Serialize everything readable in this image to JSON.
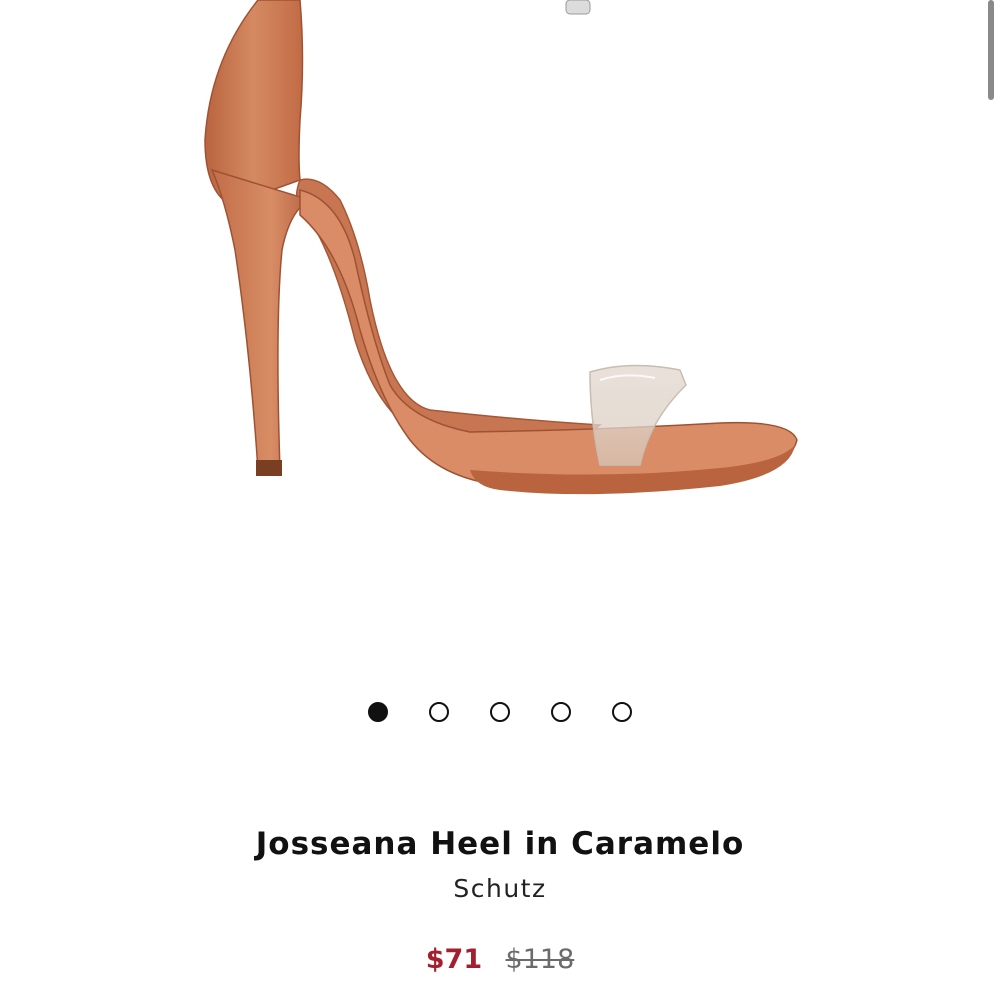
{
  "product": {
    "title": "Josseana Heel in Caramelo",
    "brand": "Schutz",
    "sale_price": "$71",
    "original_price": "$118",
    "image_alt": "heel-sandal-photo"
  },
  "carousel": {
    "total_images": 5,
    "active_index": 0
  },
  "colors": {
    "sale_price": "#a31f2d",
    "original_price": "#6b6b6b",
    "text": "#111111",
    "leather": "#c8764f"
  }
}
